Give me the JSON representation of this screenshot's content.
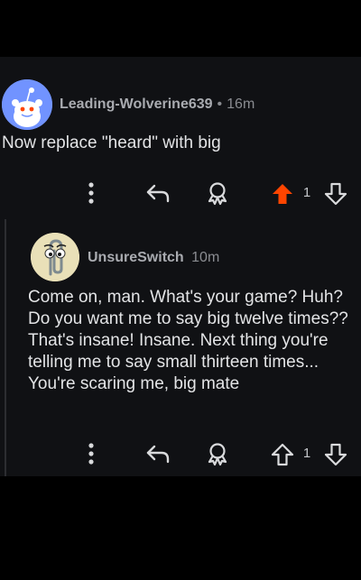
{
  "comments": [
    {
      "author": "Leading-Wolverine639",
      "separator": "•",
      "age": "16m",
      "body": "Now replace \"heard\" with big",
      "vote_count": "1",
      "upvoted": true,
      "avatar": "reddit-snoo-avatar"
    },
    {
      "author": "UnsureSwitch",
      "separator": "",
      "age": "10m",
      "body": "Come on, man. What's your game? Huh? Do you want me to say big twelve times?? That's insane! Insane. Next thing you're telling me to say small thirteen times... You're scaring me, big mate",
      "vote_count": "1",
      "upvoted": false,
      "avatar": "clippy-avatar"
    }
  ],
  "icons": {
    "more": "more-vertical-icon",
    "reply": "reply-arrow-icon",
    "award": "award-icon",
    "upvote": "upvote-arrow-icon",
    "downvote": "downvote-arrow-icon"
  },
  "colors": {
    "background": "#101114",
    "upvote_active": "#ff4500",
    "text": "#e3e4e6",
    "muted": "#8a8c91"
  }
}
